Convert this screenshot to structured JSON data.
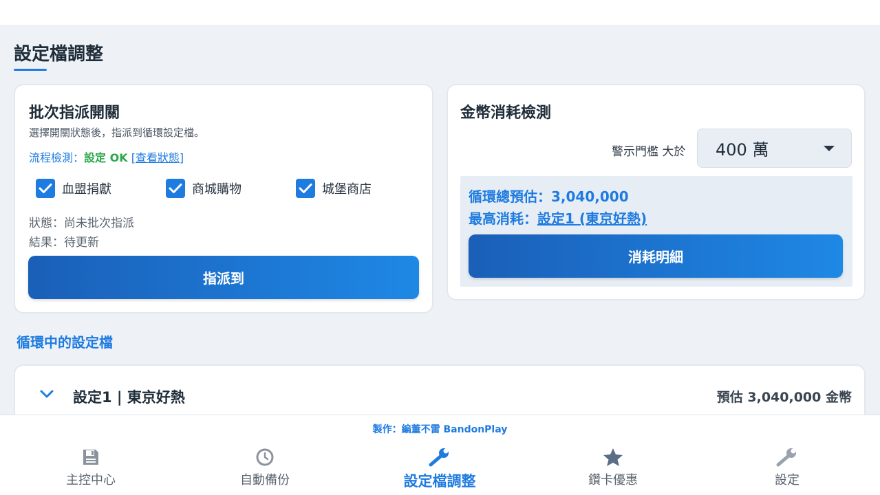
{
  "page": {
    "title": "設定檔調整"
  },
  "batch": {
    "title": "批次指派開關",
    "description": "選擇開關狀態後，指派到循環設定檔。",
    "flow_prefix": "流程檢測：",
    "flow_ok": "設定 OK",
    "flow_link": "[查看狀態]",
    "checkboxes": [
      {
        "label": "血盟捐獻",
        "checked": true
      },
      {
        "label": "商城購物",
        "checked": true
      },
      {
        "label": "城堡商店",
        "checked": true
      }
    ],
    "status": "狀態：尚未批次指派",
    "result": "結果：待更新",
    "assign_button": "指派到"
  },
  "gold": {
    "title": "金幣消耗檢測",
    "threshold_label": "警示門檻 大於",
    "threshold_value": "400 萬",
    "total_prefix": "循環總預估：",
    "total_value": "3,040,000",
    "max_prefix": "最高消耗：",
    "max_value": "設定1 (東京好熱)",
    "detail_button": "消耗明細"
  },
  "cycle": {
    "section_title": "循環中的設定檔",
    "profiles": [
      {
        "name": "設定1 | 東京好熱",
        "estimate": "預估 3,040,000 金幣"
      }
    ]
  },
  "footer": {
    "credit": "製作：編董不雷 BandonPlay",
    "nav": [
      {
        "label": "主控中心",
        "icon": "save-icon",
        "active": false
      },
      {
        "label": "自動備份",
        "icon": "clock-icon",
        "active": false
      },
      {
        "label": "設定檔調整",
        "icon": "wrench-icon",
        "active": true
      },
      {
        "label": "鑽卡優惠",
        "icon": "star-icon",
        "active": false
      },
      {
        "label": "設定",
        "icon": "wrench-icon",
        "active": false
      }
    ]
  },
  "colors": {
    "accent": "#1e7be0",
    "ok": "#2aa84a",
    "background": "#eef2f7"
  }
}
